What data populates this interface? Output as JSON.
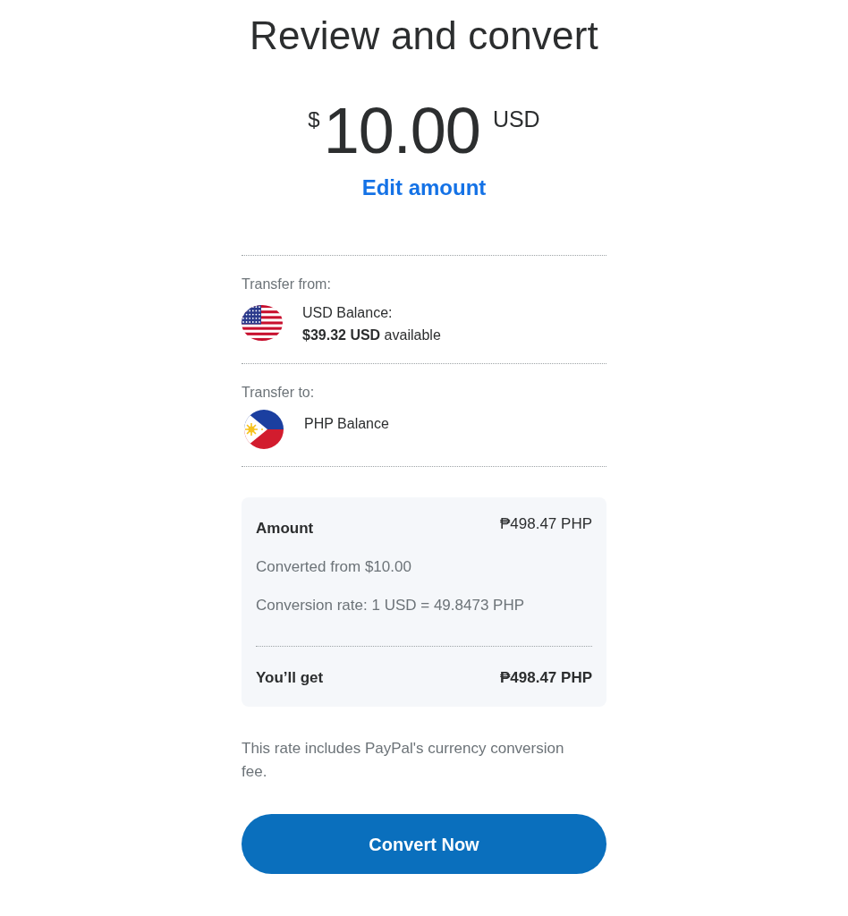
{
  "title": "Review and convert",
  "amount": {
    "currency_symbol": "$",
    "value": "10.00",
    "currency_code": "USD"
  },
  "edit_link": "Edit amount",
  "transfers": [
    {
      "label": "Transfer from:",
      "kind": "usd",
      "account": "USD Balance:",
      "detail": "**$39.32 USD** available"
    },
    {
      "label": "Transfer to:",
      "kind": "php",
      "account": "PHP Balance"
    }
  ],
  "summary": {
    "rows": [
      {
        "kind": "heading",
        "label": "Amount",
        "value": "₱498.47 PHP"
      },
      {
        "kind": "note",
        "label": "Converted from $10.00"
      },
      {
        "kind": "note",
        "label": "Conversion rate: 1 USD = 49.8473 PHP"
      },
      {
        "kind": "total",
        "label": "You’ll get",
        "value": "₱498.47 PHP"
      }
    ]
  },
  "disclaimer": "This rate includes PayPal's currency conversion fee.",
  "button": "Convert Now"
}
